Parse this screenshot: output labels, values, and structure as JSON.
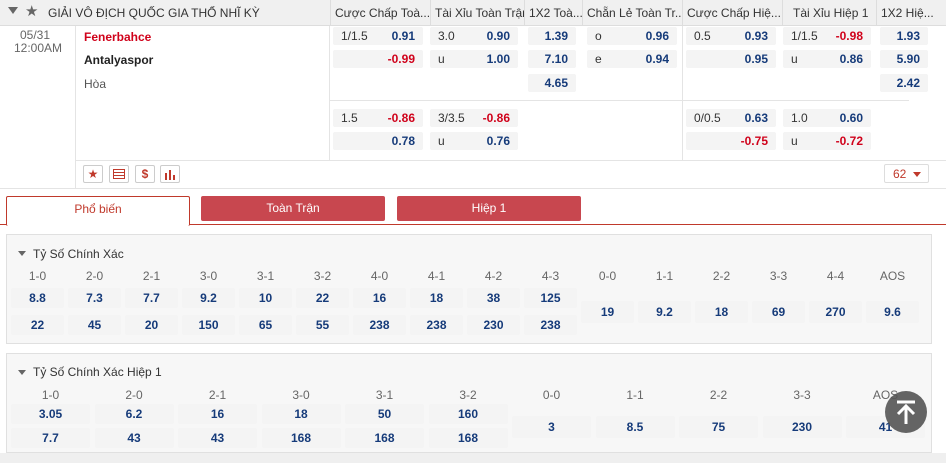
{
  "header": {
    "league": "GIẢI VÔ ĐỊCH QUỐC GIA THỔ NHĨ KỲ",
    "columns": [
      "Cược Chấp Toà...",
      "Tài Xỉu Toàn Trận",
      "1X2 Toà...",
      "Chẵn Lẻ Toàn Tr...",
      "Cược Chấp Hiệ...",
      "Tài Xỉu Hiệp 1",
      "1X2 Hiệ..."
    ]
  },
  "match": {
    "date": "05/31",
    "time": "12:00AM",
    "home": "Fenerbahce",
    "away": "Antalyaspor",
    "draw": "Hòa",
    "stats_count": "62",
    "accent": "#c0392b"
  },
  "odds": {
    "r1": {
      "hdp_line": "1/1.5",
      "hdp_home": "0.91",
      "hdp_away": "-0.99",
      "ou_line": "3.0",
      "ou_over": "0.90",
      "ou_under_label": "u",
      "ou_under": "1.00",
      "x12_home": "1.39",
      "x12_away": "7.10",
      "x12_draw": "4.65",
      "oe_odd_label": "o",
      "oe_odd": "0.96",
      "oe_even_label": "e",
      "oe_even": "0.94",
      "h1_hdp_line": "0.5",
      "h1_hdp_home": "0.93",
      "h1_hdp_away": "0.95",
      "h1_ou_line": "1/1.5",
      "h1_ou_over": "-0.98",
      "h1_ou_under_label": "u",
      "h1_ou_under": "0.86",
      "h1_x12_home": "1.93",
      "h1_x12_away": "5.90",
      "h1_x12_draw": "2.42"
    },
    "r2": {
      "hdp_line": "1.5",
      "hdp_home": "-0.86",
      "hdp_away": "0.78",
      "ou_line": "3/3.5",
      "ou_over": "-0.86",
      "ou_under_label": "u",
      "ou_under": "0.76",
      "h1_hdp_line": "0/0.5",
      "h1_hdp_home": "0.63",
      "h1_hdp_away": "-0.75",
      "h1_ou_line": "1.0",
      "h1_ou_over": "0.60",
      "h1_ou_under_label": "u",
      "h1_ou_under": "-0.72"
    }
  },
  "tabs": [
    "Phổ biến",
    "Toàn Trận",
    "Hiệp 1"
  ],
  "correct_score": {
    "title": "Tỷ Số Chính Xác",
    "headers": [
      "1-0",
      "2-0",
      "2-1",
      "3-0",
      "3-1",
      "3-2",
      "4-0",
      "4-1",
      "4-2",
      "4-3",
      "0-0",
      "1-1",
      "2-2",
      "3-3",
      "4-4",
      "AOS"
    ],
    "home_row": [
      "8.8",
      "7.3",
      "7.7",
      "9.2",
      "10",
      "22",
      "16",
      "18",
      "38",
      "125"
    ],
    "away_row": [
      "22",
      "45",
      "20",
      "150",
      "65",
      "55",
      "238",
      "238",
      "230",
      "238"
    ],
    "draw_row": [
      "19",
      "9.2",
      "18",
      "69",
      "270",
      "9.6"
    ]
  },
  "correct_score_h1": {
    "title": "Tỷ Số Chính Xác Hiệp 1",
    "headers": [
      "1-0",
      "2-0",
      "2-1",
      "3-0",
      "3-1",
      "3-2",
      "0-0",
      "1-1",
      "2-2",
      "3-3",
      "AOS"
    ],
    "home_row": [
      "3.05",
      "6.2",
      "16",
      "18",
      "50",
      "160"
    ],
    "away_row": [
      "7.7",
      "43",
      "43",
      "168",
      "168",
      "168"
    ],
    "draw_row": [
      "3",
      "8.5",
      "75",
      "230",
      "41"
    ]
  }
}
